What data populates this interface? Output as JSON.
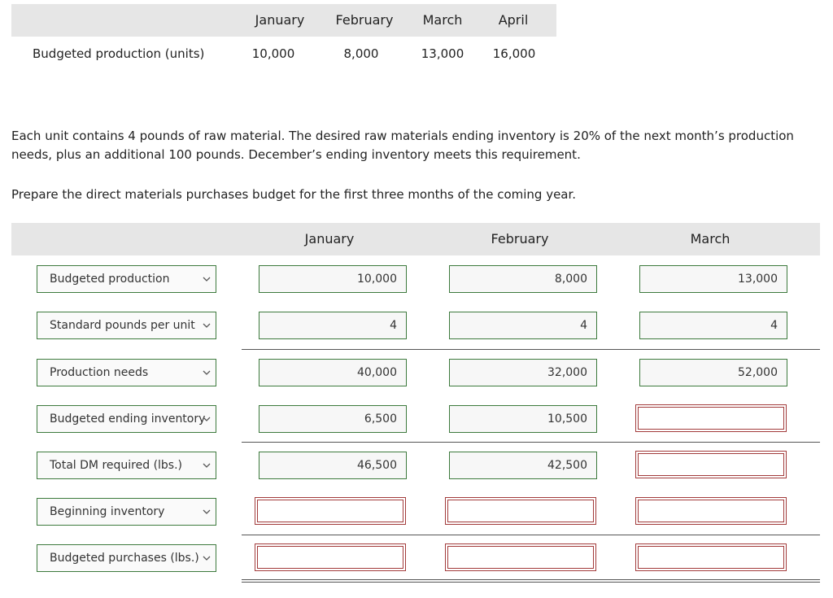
{
  "top_table": {
    "months": [
      "January",
      "February",
      "March",
      "April"
    ],
    "row_label": "Budgeted production (units)",
    "values": [
      "10,000",
      "8,000",
      "13,000",
      "16,000"
    ]
  },
  "instructions": {
    "paragraph": "Each unit contains 4 pounds of raw material. The desired raw materials ending inventory is 20% of the next month’s production needs, plus an additional 100 pounds. December’s ending inventory meets this requirement.",
    "prompt": "Prepare the direct materials purchases budget for the first three months of the coming year."
  },
  "budget": {
    "months": [
      "January",
      "February",
      "March"
    ],
    "rows": [
      {
        "label": "Budgeted production",
        "values": [
          "10,000",
          "8,000",
          "13,000"
        ]
      },
      {
        "label": "Standard pounds per unit",
        "values": [
          "4",
          "4",
          "4"
        ]
      },
      {
        "label": "Production needs",
        "values": [
          "40,000",
          "32,000",
          "52,000"
        ]
      },
      {
        "label": "Budgeted ending inventory",
        "values": [
          "6,500",
          "10,500",
          ""
        ]
      },
      {
        "label": "Total DM required (lbs.)",
        "values": [
          "46,500",
          "42,500",
          ""
        ]
      },
      {
        "label": "Beginning inventory",
        "values": [
          "",
          "",
          ""
        ]
      },
      {
        "label": "Budgeted purchases (lbs.)",
        "values": [
          "",
          "",
          ""
        ]
      }
    ]
  }
}
